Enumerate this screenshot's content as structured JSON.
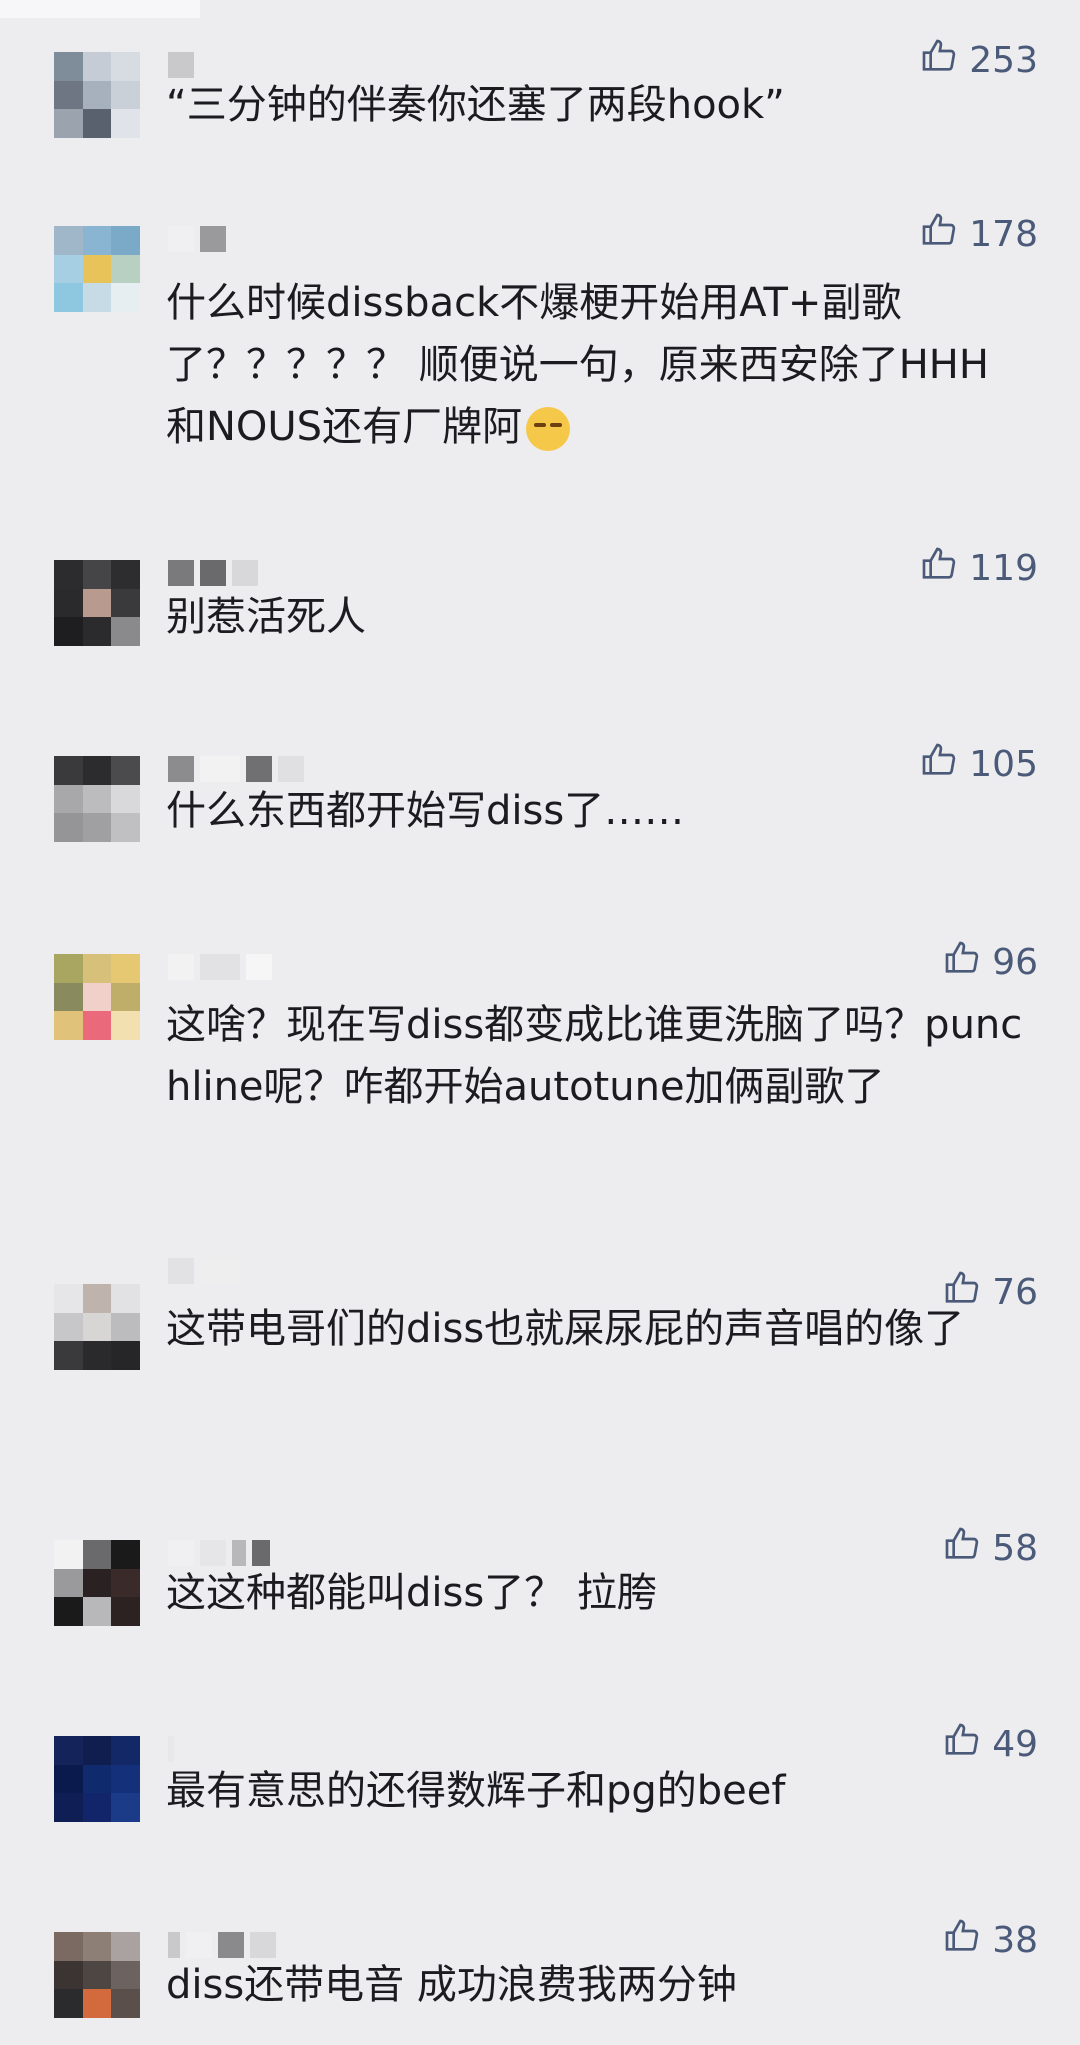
{
  "comments": [
    {
      "likes": "253",
      "text": "“三分钟的伴奏你还塞了两段hook”",
      "avatar": [
        "#7f8c9a",
        "#c6ccd5",
        "#d7dce3",
        "#6d7682",
        "#a7b0bd",
        "#c9d0d8",
        "#9aa3ae",
        "#58616d",
        "#e0e4ea"
      ]
    },
    {
      "likes": "178",
      "text": "什么时候dissback不爆梗开始用AT+副歌了？？？？？ 顺便说一句，原来西安除了HHH和NOUS还有厂牌阿",
      "emoji": true,
      "avatar": [
        "#9fb7c8",
        "#8ab5d2",
        "#7aaac8",
        "#a6cfe4",
        "#e7c35a",
        "#b7d0c2",
        "#8ec7e0",
        "#c7dbe7",
        "#e7eef2"
      ]
    },
    {
      "likes": "119",
      "text": "别惹活死人",
      "avatar": [
        "#2c2c2e",
        "#454548",
        "#2d2d30",
        "#2a2a2c",
        "#b89a8e",
        "#3a3a3d",
        "#1e1e20",
        "#2b2b2d",
        "#8a8a8c"
      ]
    },
    {
      "likes": "105",
      "text": "什么东西都开始写diss了……",
      "avatar": [
        "#3a3a3c",
        "#2c2c2e",
        "#4b4b4e",
        "#a8a8ab",
        "#bcbcbf",
        "#d9d9db",
        "#959598",
        "#a0a0a3",
        "#c0c0c2"
      ]
    },
    {
      "likes": "96",
      "text": "这啥？现在写diss都变成比谁更洗脑了吗？punchline呢？咋都开始autotune加俩副歌了",
      "avatar": [
        "#a8a660",
        "#d7c07a",
        "#e6c873",
        "#8a8a5f",
        "#f0d0c8",
        "#bfae6a",
        "#e0c27b",
        "#ea6a7c",
        "#f3e0b0"
      ]
    },
    {
      "likes": "76",
      "text": "这带电哥们的diss也就屎尿屁的声音唱的像了",
      "avatar": [
        "#e6e6e8",
        "#bfb4ad",
        "#e2e2e4",
        "#c7c7c9",
        "#d8d6d4",
        "#bcbcbe",
        "#3a3a3d",
        "#2a2a2c",
        "#262628"
      ]
    },
    {
      "likes": "58",
      "text": "这这种都能叫diss了？ 拉胯",
      "avatar": [
        "#f2f2f3",
        "#6a6a6c",
        "#1a1a1a",
        "#9a9a9c",
        "#2a2222",
        "#3a2a2a",
        "#1a1a1a",
        "#b8b8ba",
        "#2c2222"
      ]
    },
    {
      "likes": "49",
      "text": "最有意思的还得数辉子和pg的beef",
      "avatar": [
        "#14235a",
        "#0f1d4f",
        "#132866",
        "#0b1a4c",
        "#102a6e",
        "#15307a",
        "#0f1f55",
        "#12256a",
        "#1b3a88"
      ]
    },
    {
      "likes": "38",
      "text": "diss还带电音 成功浪费我两分钟",
      "avatar": [
        "#7a6a62",
        "#8e7f76",
        "#a9a2a0",
        "#3b3433",
        "#4d4643",
        "#6c6360",
        "#2b2a2c",
        "#d26a3e",
        "#5a4f4b"
      ]
    }
  ]
}
